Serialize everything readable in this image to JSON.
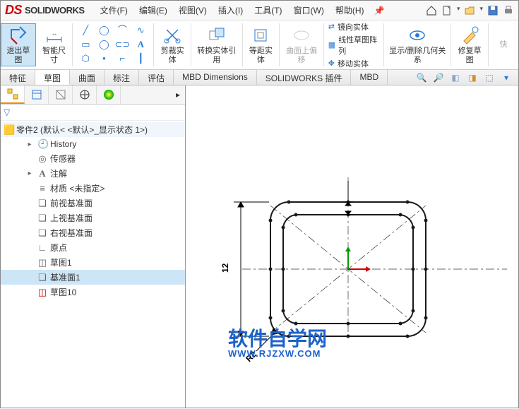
{
  "app": {
    "title": "SOLIDWORKS"
  },
  "menus": [
    {
      "label": "文件(F)"
    },
    {
      "label": "编辑(E)"
    },
    {
      "label": "视图(V)"
    },
    {
      "label": "插入(I)"
    },
    {
      "label": "工具(T)"
    },
    {
      "label": "窗口(W)"
    },
    {
      "label": "帮助(H)"
    }
  ],
  "ribbon": {
    "exit_sketch": "退出草图",
    "smart_dim": "智能尺寸",
    "trim": "剪裁实体",
    "convert": "转换实体引用",
    "offset": "等距实体",
    "offset_surface": "曲面上偏移",
    "mirror": "镜向实体",
    "pattern": "线性草图阵列",
    "move": "移动实体",
    "show_rel": "显示/删除几何关系",
    "repair": "修复草图",
    "quick": "快"
  },
  "tabs": [
    "特征",
    "草图",
    "曲面",
    "标注",
    "评估",
    "MBD Dimensions",
    "SOLIDWORKS 插件",
    "MBD"
  ],
  "active_tab": 1,
  "tree": {
    "root": "零件2  (默认< <默认>_显示状态 1>)",
    "items": [
      {
        "label": "History",
        "icon": "clock",
        "expandable": true
      },
      {
        "label": "传感器",
        "icon": "sensor"
      },
      {
        "label": "注解",
        "icon": "annotation",
        "expandable": true
      },
      {
        "label": "材质 <未指定>",
        "icon": "material"
      },
      {
        "label": "前视基准面",
        "icon": "plane"
      },
      {
        "label": "上视基准面",
        "icon": "plane"
      },
      {
        "label": "右视基准面",
        "icon": "plane"
      },
      {
        "label": "原点",
        "icon": "origin"
      },
      {
        "label": "草图1",
        "icon": "sketch"
      },
      {
        "label": "基准面1",
        "icon": "plane",
        "selected": true
      },
      {
        "label": "草图10",
        "icon": "sketch",
        "active": true
      }
    ]
  },
  "dimensions": {
    "height": "12",
    "radius": "R2"
  },
  "watermark": {
    "line1": "软件自学网",
    "line2": "WWW.RJZXW.COM"
  }
}
